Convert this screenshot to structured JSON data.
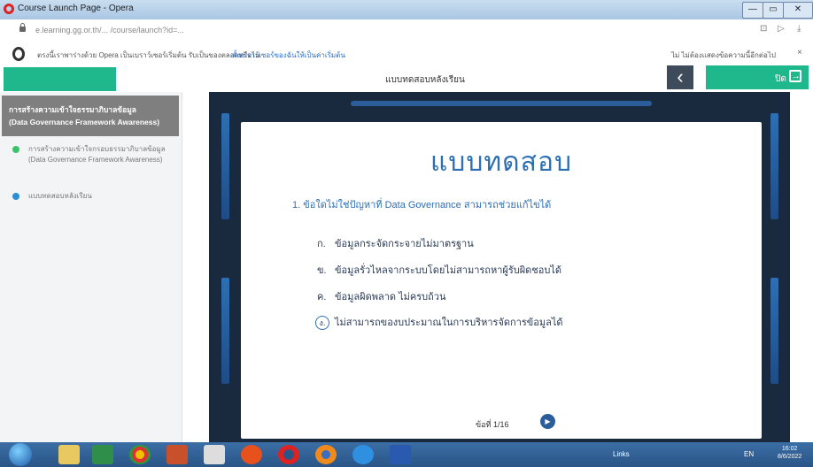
{
  "window": {
    "title": "Course Launch Page - Opera",
    "controls": [
      "—",
      "▭",
      "✕"
    ]
  },
  "address_bar": {
    "url": "e.learning.gg.or.th/... /course/launch?id=...",
    "icons": [
      "reader-icon",
      "send-icon",
      "download-icon"
    ]
  },
  "info_bar": {
    "message": "ตรงนี้เราพาร่างด้วย Opera เป็นเบราว์เซอร์เริ่มต้น รับเป็นของตลอดหรือไม่",
    "link": "ตั้งเบราว์เซอร์ของฉันให้เป็นค่าเริ่มต้น",
    "right_text": "ไม่ ไม่ต้องแสดงข้อความนี้อีกต่อไป",
    "close": "×"
  },
  "course": {
    "title": "แบบทดสอบหลังเรียน",
    "back_icon": "‹",
    "close_label": "ปิด",
    "close_icon": "→"
  },
  "sidebar": {
    "header_line1": "การสร้างความเข้าใจธรรมาภิบาลข้อมูล",
    "header_line2": "(Data Governance Framework Awareness)",
    "items": [
      {
        "label": "การสร้างความเข้าใจกรอบธรรมาภิบาลข้อมูล (Data Governance Framework Awareness)",
        "status_color": "#3cc26a"
      },
      {
        "label": "แบบทดสอบหลังเรียน",
        "status_color": "#2a8fd6"
      }
    ]
  },
  "quiz": {
    "heading": "แบบทดสอบ",
    "question": "1. ข้อใดไม่ใช่ปัญหาที่ Data Governance สามารถช่วยแก้ไขได้",
    "choices": [
      {
        "key": "ก.",
        "text": "ข้อมูลกระจัดกระจายไม่มาตรฐาน"
      },
      {
        "key": "ข.",
        "text": "ข้อมูลรั่วไหลจากระบบโดยไม่สามารถหาผู้รับผิดชอบได้"
      },
      {
        "key": "ค.",
        "text": "ข้อมูลผิดพลาด ไม่ครบถ้วน"
      },
      {
        "key": "ง.",
        "text": "ไม่สามารถของบประมาณในการบริหารจัดการข้อมูลได้"
      }
    ],
    "selected": "ง.",
    "pager": "ข้อที่ 1/16",
    "next_icon": "▶"
  },
  "taskbar": {
    "links_label": "Links",
    "lang": "EN",
    "time": "16:02",
    "date": "8/6/2022",
    "apps": [
      "explorer",
      "excel",
      "chrome",
      "powerpoint",
      "media",
      "office",
      "opera",
      "firefox",
      "ie",
      "word"
    ]
  },
  "colors": {
    "accent_green": "#1eb88c",
    "accent_blue": "#2d6fb3",
    "frame_dark": "#1a2a3e"
  }
}
